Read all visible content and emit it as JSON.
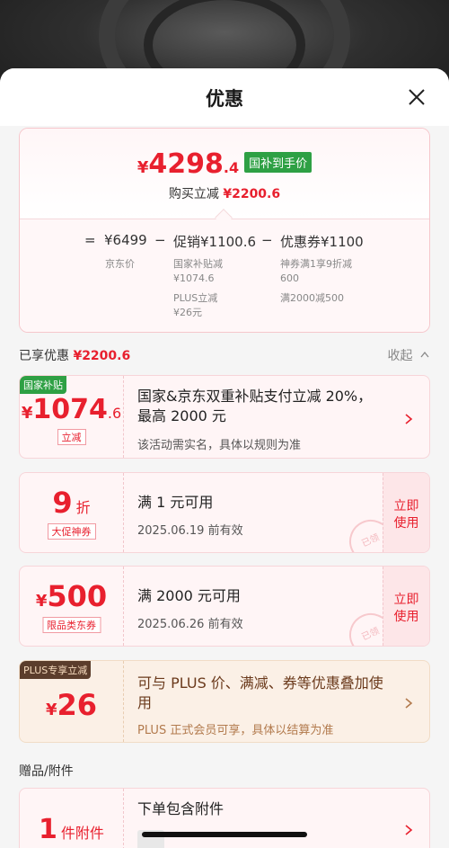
{
  "sheet": {
    "title": "优惠"
  },
  "summary": {
    "currency": "¥",
    "price_int": "4298",
    "price_dec": ".4",
    "gov_tag": "国补到手价",
    "reduce_label": "购买立减",
    "reduce_value": "¥2200.6",
    "formula": {
      "eq": "=",
      "base": "¥6499",
      "base_label": "京东价",
      "minus1": "−",
      "promo": "促销¥1100.6",
      "promo_sub1": "国家补贴减\n¥1074.6",
      "promo_sub2": "PLUS立减\n¥26元",
      "minus2": "−",
      "coupon": "优惠券¥1100",
      "coupon_sub1": "神券满1享9折减\n600",
      "coupon_sub2": "满2000减500"
    }
  },
  "enjoyed": {
    "label": "已享优惠",
    "value": "¥2200.6",
    "collapse": "收起"
  },
  "cards": {
    "subsidy": {
      "corner": "国家补贴",
      "sym": "¥",
      "int": "1074",
      "dec": ".6",
      "tag": "立减",
      "title": "国家&京东双重补贴支付立减 20%，最高 2000 元",
      "sub": "该活动需实名，具体以规则为准"
    },
    "discount": {
      "num": "9",
      "unit": "折",
      "tag": "大促神券",
      "title": "满 1 元可用",
      "sub": "2025.06.19 前有效",
      "btn": "立即\n使用",
      "stamp": "已领"
    },
    "coupon500": {
      "sym": "¥",
      "num": "500",
      "tag": "限品类东券",
      "title": "满 2000 元可用",
      "sub": "2025.06.26 前有效",
      "btn": "立即\n使用",
      "stamp": "已领"
    },
    "plus": {
      "corner": "PLUS专享立减",
      "sym": "¥",
      "num": "26",
      "title": "可与 PLUS 价、满减、券等优惠叠加使用",
      "sub": "PLUS 正式会员可享，具体以结算为准"
    }
  },
  "gift": {
    "section": "赠品/附件",
    "num": "1",
    "unit": "件附件",
    "title": "下单包含附件"
  },
  "colors": {
    "accent_red": "#e8202e",
    "gov_green": "#2ea044",
    "plus_brown": "#5b3d2c"
  }
}
